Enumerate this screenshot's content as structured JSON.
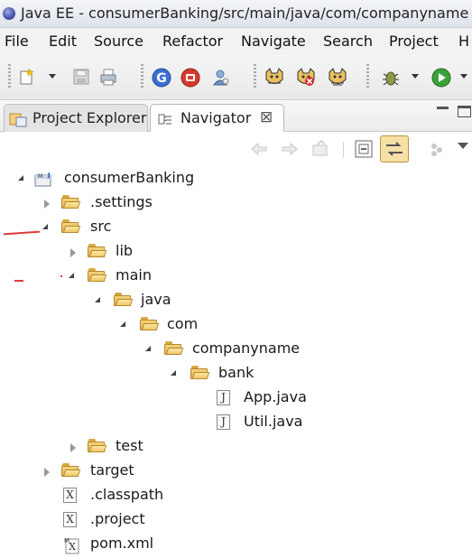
{
  "window": {
    "title": "Java EE - consumerBanking/src/main/java/com/companyname"
  },
  "menu": [
    "File",
    "Edit",
    "Source",
    "Refactor",
    "Navigate",
    "Search",
    "Project",
    "H"
  ],
  "tabs": {
    "project_explorer": "Project Explorer",
    "navigator": "Navigator",
    "close_glyph": "⊠"
  },
  "tree": [
    {
      "label": "consumerBanking",
      "icon": "project-icon",
      "state": "open"
    },
    {
      "label": ".settings",
      "icon": "folder-icon",
      "state": "closed"
    },
    {
      "label": "src",
      "icon": "folder-icon",
      "state": "open"
    },
    {
      "label": "lib",
      "icon": "folder-icon",
      "state": "closed"
    },
    {
      "label": "main",
      "icon": "folder-icon",
      "state": "open"
    },
    {
      "label": "java",
      "icon": "folder-icon",
      "state": "open"
    },
    {
      "label": "com",
      "icon": "folder-icon",
      "state": "open"
    },
    {
      "label": "companyname",
      "icon": "folder-icon",
      "state": "open"
    },
    {
      "label": "bank",
      "icon": "folder-icon",
      "state": "open"
    },
    {
      "label": "App.java",
      "icon": "java-file-icon",
      "state": "leaf"
    },
    {
      "label": "Util.java",
      "icon": "java-file-icon",
      "state": "leaf"
    },
    {
      "label": "test",
      "icon": "folder-icon",
      "state": "closed"
    },
    {
      "label": "target",
      "icon": "folder-icon",
      "state": "closed"
    },
    {
      "label": ".classpath",
      "icon": "xml-file-icon",
      "state": "leaf"
    },
    {
      "label": ".project",
      "icon": "xml-file-icon",
      "state": "leaf"
    },
    {
      "label": "pom.xml",
      "icon": "maven-file-icon",
      "state": "leaf"
    }
  ],
  "file_glyphs": {
    "java": "J",
    "xml": "X"
  },
  "colors": {
    "annotation_red": "#e23a3a",
    "folder_yellow": "#f1c766"
  }
}
